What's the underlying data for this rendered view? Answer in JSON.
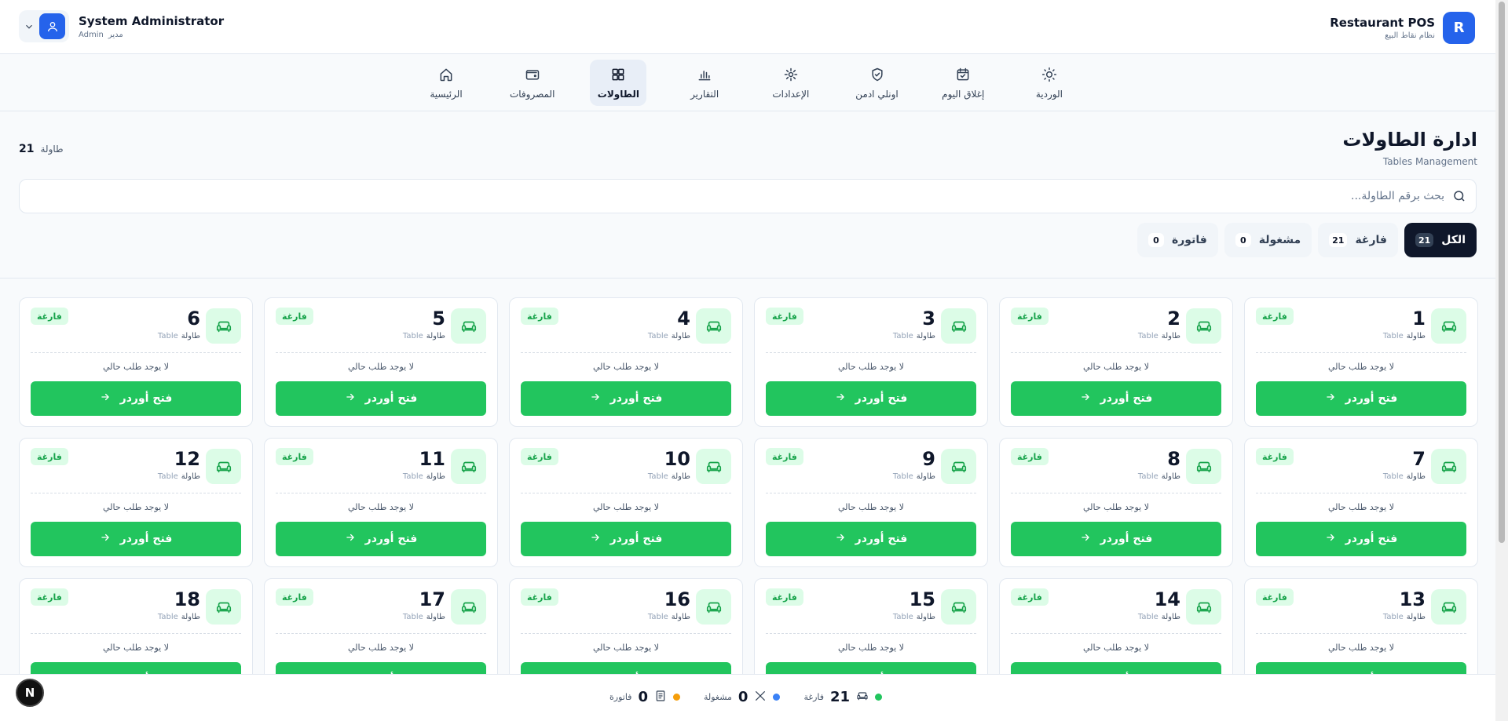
{
  "brand": {
    "logo_letter": "R",
    "title": "Restaurant POS",
    "subtitle": "نظام نقاط البيع"
  },
  "user": {
    "name": "System Administrator",
    "role_en": "Admin",
    "role_ar": "مدير"
  },
  "nav": [
    {
      "label": "الرئيسية",
      "icon": "home-icon"
    },
    {
      "label": "المصروفات",
      "icon": "wallet-icon"
    },
    {
      "label": "الطاولات",
      "icon": "grid-icon",
      "active": true
    },
    {
      "label": "التقارير",
      "icon": "bar-chart-icon"
    },
    {
      "label": "الإعدادات",
      "icon": "gear-icon"
    },
    {
      "label": "اونلي ادمن",
      "icon": "shield-icon"
    },
    {
      "label": "إغلاق اليوم",
      "icon": "calendar-check-icon"
    },
    {
      "label": "الوردية",
      "icon": "sun-icon"
    }
  ],
  "page": {
    "title": "ادارة الطاولات",
    "subtitle": "Tables Management",
    "count_value": "21",
    "count_label": "طاولة"
  },
  "search": {
    "placeholder": "بحث برقم الطاولة..."
  },
  "filters": [
    {
      "label": "الكل",
      "count": "21",
      "active": true
    },
    {
      "label": "فارغة",
      "count": "21"
    },
    {
      "label": "مشغولة",
      "count": "0"
    },
    {
      "label": "فاتورة",
      "count": "0"
    }
  ],
  "card_text": {
    "table_ar": "طاولة",
    "table_en": "Table",
    "status": "فارغة",
    "no_order": "لا يوجد طلب حالي",
    "open_button": "فتح أوردر"
  },
  "tables": [
    "1",
    "2",
    "3",
    "4",
    "5",
    "6",
    "7",
    "8",
    "9",
    "10",
    "11",
    "12",
    "13",
    "14",
    "15",
    "16",
    "17",
    "18"
  ],
  "bottom_stats": [
    {
      "value": "21",
      "label": "فارغة",
      "color": "#22c55e",
      "icon": "sofa-icon"
    },
    {
      "value": "0",
      "label": "مشغولة",
      "color": "#3b82f6",
      "icon": "utensils-icon"
    },
    {
      "value": "0",
      "label": "فاتورة",
      "color": "#f59e0b",
      "icon": "receipt-icon"
    }
  ],
  "dev_badge": "N",
  "colors": {
    "primary": "#2563eb",
    "success": "#22c55e",
    "dark": "#0f172a"
  }
}
